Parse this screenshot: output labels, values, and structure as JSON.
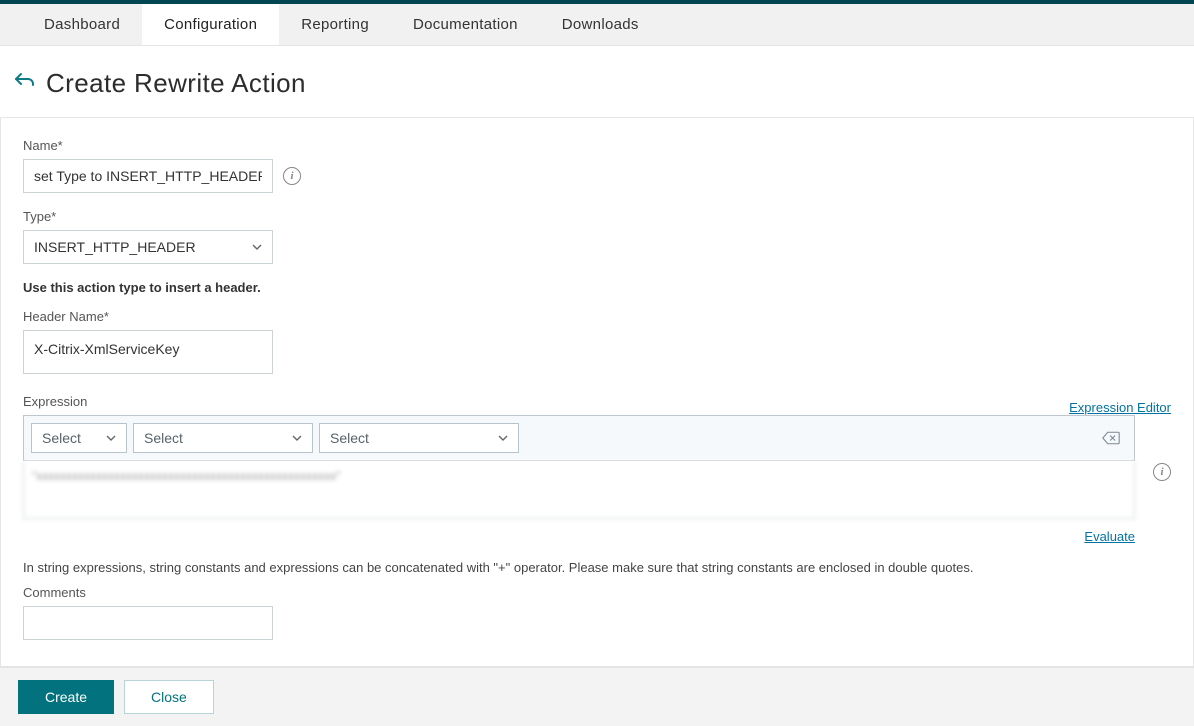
{
  "tabs": [
    "Dashboard",
    "Configuration",
    "Reporting",
    "Documentation",
    "Downloads"
  ],
  "activeTab": 1,
  "pageTitle": "Create Rewrite Action",
  "form": {
    "nameLabel": "Name*",
    "nameValue": "set Type to INSERT_HTTP_HEADER",
    "typeLabel": "Type*",
    "typeValue": "INSERT_HTTP_HEADER",
    "typeHint": "Use this action type to insert a header.",
    "headerNameLabel": "Header Name*",
    "headerNameValue": "X-Citrix-XmlServiceKey",
    "expressionLabel": "Expression",
    "expressionEditorLink": "Expression Editor",
    "selectPlaceholder": "Select",
    "expressionText": "\"xxxxxxxxxxxxxxxxxxxxxxxxxxxxxxxxxxxxxxxxxxxxxxxxxx\"",
    "evaluateLink": "Evaluate",
    "concatHint": "In string expressions, string constants and expressions can be concatenated with \"+\" operator. Please make sure that string constants are enclosed in double quotes.",
    "commentsLabel": "Comments"
  },
  "buttons": {
    "create": "Create",
    "close": "Close"
  }
}
